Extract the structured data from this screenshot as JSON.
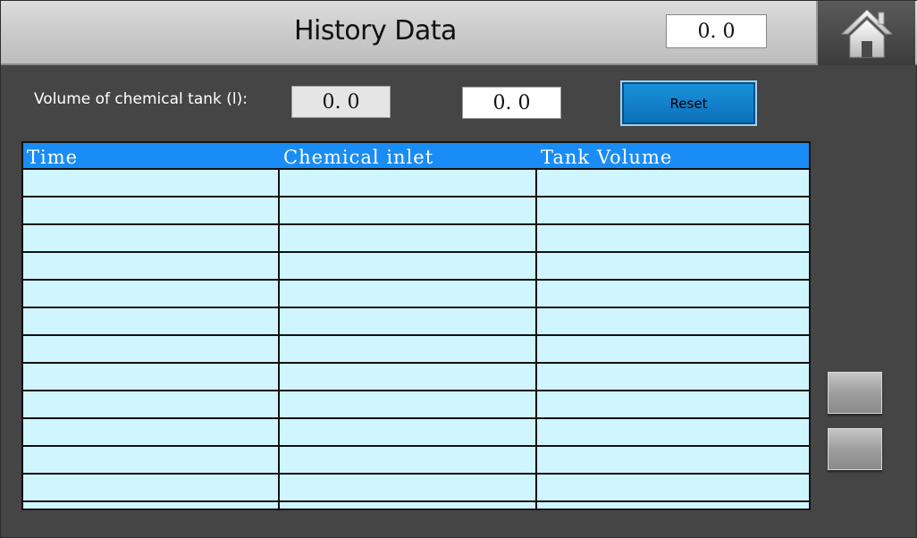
{
  "header": {
    "title": "History Data",
    "value": "0. 0"
  },
  "volume": {
    "label": "Volume of chemical tank (l):",
    "value_1": "0. 0",
    "value_2": "0. 0",
    "reset_label": "Reset"
  },
  "table": {
    "columns": [
      "Time",
      "Chemical inlet",
      "Tank Volume"
    ],
    "rows": [
      [
        "",
        "",
        ""
      ],
      [
        "",
        "",
        ""
      ],
      [
        "",
        "",
        ""
      ],
      [
        "",
        "",
        ""
      ],
      [
        "",
        "",
        ""
      ],
      [
        "",
        "",
        ""
      ],
      [
        "",
        "",
        ""
      ],
      [
        "",
        "",
        ""
      ],
      [
        "",
        "",
        ""
      ],
      [
        "",
        "",
        ""
      ],
      [
        "",
        "",
        ""
      ],
      [
        "",
        "",
        ""
      ],
      [
        "",
        "",
        ""
      ]
    ]
  },
  "icons": {
    "home": "home-icon",
    "scroll_up": "scroll-up-button",
    "scroll_down": "scroll-down-button"
  },
  "colors": {
    "background": "#454545",
    "table_header": "#1a8cf5",
    "table_body": "#cff5ff",
    "reset_button": "#0b7fcc"
  }
}
